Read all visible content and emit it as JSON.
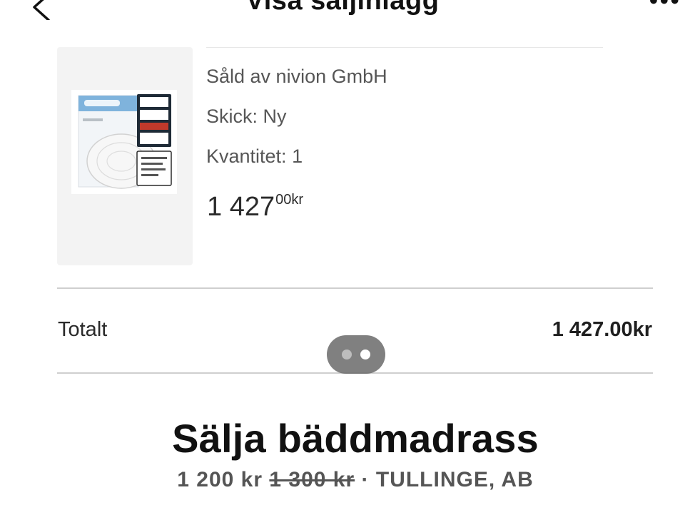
{
  "header": {
    "title": "Visa säljinlägg"
  },
  "order": {
    "seller": "Såld av nivion GmbH",
    "condition": "Skick: Ny",
    "quantity": "Kvantitet: 1",
    "price_main": "1 427",
    "price_sup": "00kr"
  },
  "totals": {
    "label": "Totalt",
    "value": "1 427.00kr"
  },
  "pager": {
    "count": 2,
    "active_index": 1
  },
  "listing": {
    "title": "Sälja bäddmadrass",
    "price": "1 200 kr",
    "old_price": "1 300 kr",
    "separator": "·",
    "location": "TULLINGE, AB"
  },
  "icons": {
    "back": "chevron-left-icon",
    "more": "more-horizontal-icon"
  },
  "colors": {
    "pager_bg": "#6e6e6e",
    "text_primary": "#111111",
    "text_secondary": "#565656"
  }
}
